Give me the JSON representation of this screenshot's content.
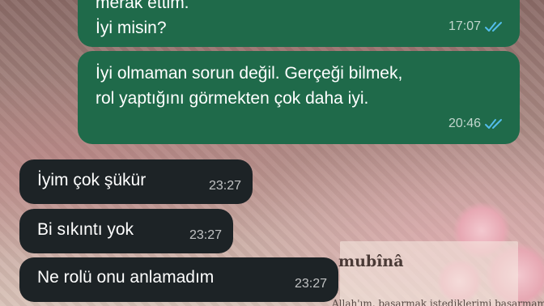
{
  "wallpaper": {
    "title": "mubînâ",
    "subtitle": "Allah'ım, başarmak istediklerimi başarmamı nasip eyle."
  },
  "messages": [
    {
      "direction": "outgoing",
      "text_lines": [
        "merak ettim.",
        "İyi misin?"
      ],
      "time": "17:07",
      "status_icon": "double-check-read-icon"
    },
    {
      "direction": "outgoing",
      "text_lines": [
        "İyi olmaman sorun değil. Gerçeği bilmek,",
        "rol yaptığını görmekten çok daha iyi."
      ],
      "time": "20:46",
      "status_icon": "double-check-read-icon"
    },
    {
      "direction": "incoming",
      "text": "İyim çok şükür",
      "time": "23:27"
    },
    {
      "direction": "incoming",
      "text": "Bi sıkıntı yok",
      "time": "23:27"
    },
    {
      "direction": "incoming",
      "text": "Ne rolü onu anlamadım",
      "time": "23:27"
    }
  ],
  "colors": {
    "outgoing_bubble": "#1f6a4a",
    "incoming_bubble": "#1d2326",
    "read_tick": "#53bdeb"
  }
}
